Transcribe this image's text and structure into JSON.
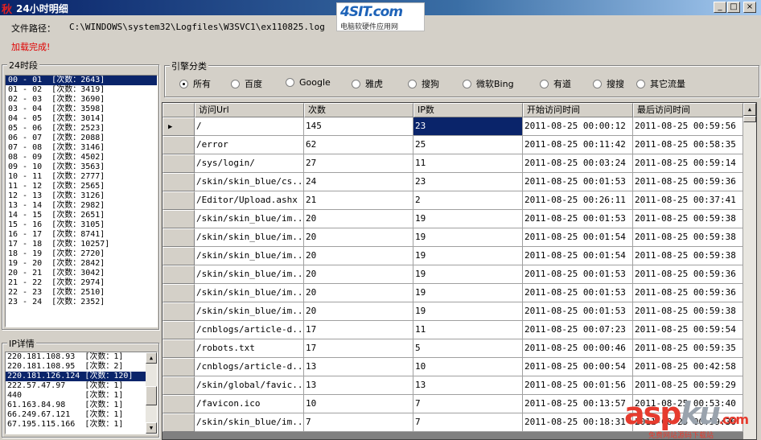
{
  "window": {
    "icon_glyph": "秋",
    "title": "24小时明细",
    "minimize_glyph": "_",
    "maximize_glyph": "□",
    "close_glyph": "×"
  },
  "logo": {
    "brand": "4SIT.com",
    "tagline": "电脑软硬件应用网"
  },
  "file": {
    "label": "文件路径：",
    "path": "C:\\WINDOWS\\system32\\Logfiles\\W3SVC1\\ex110825.log"
  },
  "status": "加载完成!",
  "hours_panel": {
    "title": "24时段",
    "selected_index": 0,
    "items": [
      "00 - 01  [次数：2643]",
      "01 - 02  [次数：3419]",
      "02 - 03  [次数：3690]",
      "03 - 04  [次数：3598]",
      "04 - 05  [次数：3014]",
      "05 - 06  [次数：2523]",
      "06 - 07  [次数：2088]",
      "07 - 08  [次数：3146]",
      "08 - 09  [次数：4502]",
      "09 - 10  [次数：3563]",
      "10 - 11  [次数：2777]",
      "11 - 12  [次数：2565]",
      "12 - 13  [次数：3126]",
      "13 - 14  [次数：2982]",
      "14 - 15  [次数：2651]",
      "15 - 16  [次数：3105]",
      "16 - 17  [次数：8741]",
      "17 - 18  [次数：10257]",
      "18 - 19  [次数：2720]",
      "19 - 20  [次数：2842]",
      "20 - 21  [次数：3042]",
      "21 - 22  [次数：2974]",
      "22 - 23  [次数：2510]",
      "23 - 24  [次数：2352]"
    ]
  },
  "ip_panel": {
    "title": "IP详情",
    "selected_index": 2,
    "items": [
      "220.181.108.93  [次数：1]",
      "220.181.108.95  [次数：2]",
      "220.181.126.124 [次数：120]",
      "222.57.47.97    [次数：1]",
      "440             [次数：1]",
      "61.163.84.98    [次数：1]",
      "66.249.67.121   [次数：1]",
      "67.195.115.166  [次数：1]"
    ]
  },
  "engines": {
    "title": "引擎分类",
    "selected_index": 0,
    "options": [
      "所有",
      "百度",
      "Google",
      "雅虎",
      "搜狗",
      "微软Bing",
      "有道",
      "搜搜",
      "其它流量"
    ]
  },
  "grid": {
    "columns": [
      "访问Url",
      "次数",
      "IP数",
      "开始访问时间",
      "最后访问时间"
    ],
    "current_row": 0,
    "selected_cell": {
      "row": 0,
      "col": 2
    },
    "rows": [
      [
        "/",
        "145",
        "23",
        "2011-08-25 00:00:12",
        "2011-08-25 00:59:56"
      ],
      [
        "/error",
        "62",
        "25",
        "2011-08-25 00:11:42",
        "2011-08-25 00:58:35"
      ],
      [
        "/sys/login/",
        "27",
        "11",
        "2011-08-25 00:03:24",
        "2011-08-25 00:59:14"
      ],
      [
        "/skin/skin_blue/cs...",
        "24",
        "23",
        "2011-08-25 00:01:53",
        "2011-08-25 00:59:36"
      ],
      [
        "/Editor/Upload.ashx",
        "21",
        "2",
        "2011-08-25 00:26:11",
        "2011-08-25 00:37:41"
      ],
      [
        "/skin/skin_blue/im...",
        "20",
        "19",
        "2011-08-25 00:01:53",
        "2011-08-25 00:59:38"
      ],
      [
        "/skin/skin_blue/im...",
        "20",
        "19",
        "2011-08-25 00:01:54",
        "2011-08-25 00:59:38"
      ],
      [
        "/skin/skin_blue/im...",
        "20",
        "19",
        "2011-08-25 00:01:54",
        "2011-08-25 00:59:38"
      ],
      [
        "/skin/skin_blue/im...",
        "20",
        "19",
        "2011-08-25 00:01:53",
        "2011-08-25 00:59:36"
      ],
      [
        "/skin/skin_blue/im...",
        "20",
        "19",
        "2011-08-25 00:01:53",
        "2011-08-25 00:59:36"
      ],
      [
        "/skin/skin_blue/im...",
        "20",
        "19",
        "2011-08-25 00:01:53",
        "2011-08-25 00:59:38"
      ],
      [
        "/cnblogs/article-d...",
        "17",
        "11",
        "2011-08-25 00:07:23",
        "2011-08-25 00:59:54"
      ],
      [
        "/robots.txt",
        "17",
        "5",
        "2011-08-25 00:00:46",
        "2011-08-25 00:59:35"
      ],
      [
        "/cnblogs/article-d...",
        "13",
        "10",
        "2011-08-25 00:00:54",
        "2011-08-25 00:42:58"
      ],
      [
        "/skin/global/favic...",
        "13",
        "13",
        "2011-08-25 00:01:56",
        "2011-08-25 00:59:29"
      ],
      [
        "/favicon.ico",
        "10",
        "7",
        "2011-08-25 00:13:57",
        "2011-08-25 00:53:40"
      ],
      [
        "/skin/skin_blue/im...",
        "7",
        "7",
        "2011-08-25 00:18:31",
        "2011-08-25 00:59:36"
      ]
    ]
  },
  "watermark": {
    "brand_a": "asp",
    "brand_b": "ku",
    "brand_c": ".com",
    "tagline": "免费网站源码下载站"
  }
}
